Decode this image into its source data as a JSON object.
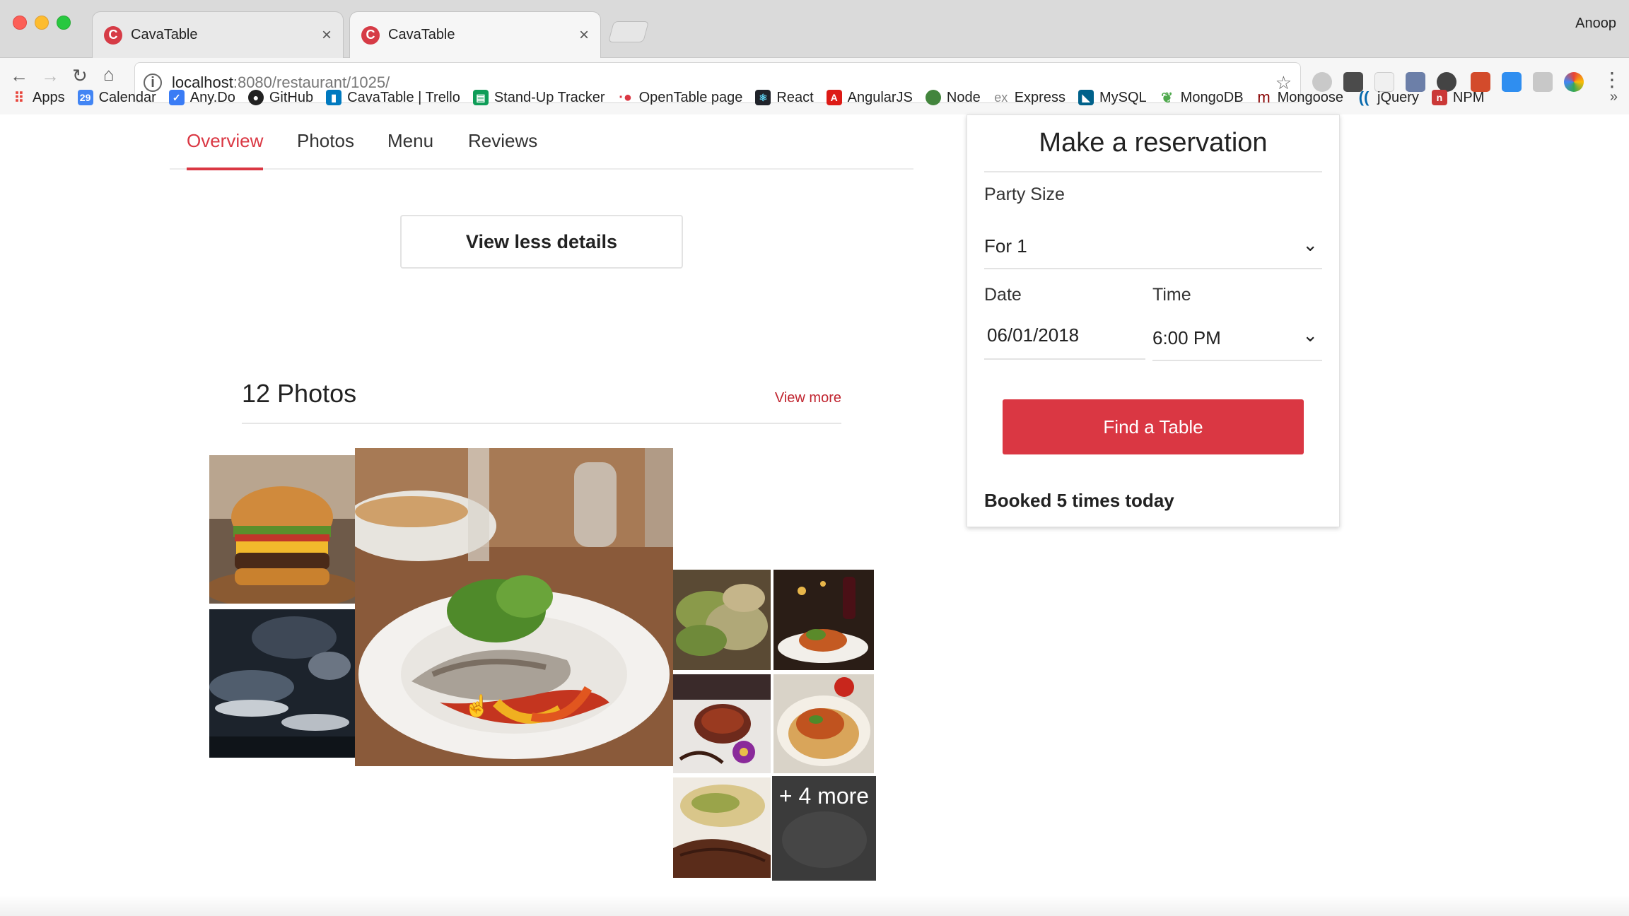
{
  "browser": {
    "tabs": [
      {
        "title": "CavaTable",
        "active": false
      },
      {
        "title": "CavaTable",
        "active": true
      }
    ],
    "profile_name": "Anoop",
    "url_host": "localhost",
    "url_path": ":8080/restaurant/1025/",
    "bookmarks": [
      {
        "label": "Apps",
        "icon": "apps-grid-icon",
        "color": "#e8453c"
      },
      {
        "label": "Calendar",
        "icon": "calendar-icon",
        "color": "#4285f4"
      },
      {
        "label": "Any.Do",
        "icon": "anydo-check-icon",
        "color": "#3a7cf5"
      },
      {
        "label": "GitHub",
        "icon": "github-icon",
        "color": "#222222"
      },
      {
        "label": "CavaTable | Trello",
        "icon": "trello-icon",
        "color": "#0079bf"
      },
      {
        "label": "Stand-Up Tracker",
        "icon": "sheets-icon",
        "color": "#0f9d58"
      },
      {
        "label": "OpenTable page",
        "icon": "opentable-icon",
        "color": "#da3743"
      },
      {
        "label": "React",
        "icon": "react-icon",
        "color": "#20232a"
      },
      {
        "label": "AngularJS",
        "icon": "angular-icon",
        "color": "#dd1b16"
      },
      {
        "label": "Node",
        "icon": "node-icon",
        "color": "#43853d"
      },
      {
        "label": "Express",
        "icon": "express-icon",
        "color": "#888888"
      },
      {
        "label": "MySQL",
        "icon": "mysql-icon",
        "color": "#00618a"
      },
      {
        "label": "MongoDB",
        "icon": "mongodb-leaf-icon",
        "color": "#4fa94d"
      },
      {
        "label": "Mongoose",
        "icon": "mongoose-icon",
        "color": "#880000"
      },
      {
        "label": "jQuery",
        "icon": "jquery-icon",
        "color": "#0769ad"
      },
      {
        "label": "NPM",
        "icon": "npm-icon",
        "color": "#cb3837"
      }
    ]
  },
  "restaurant_nav": {
    "tabs": [
      "Overview",
      "Photos",
      "Menu",
      "Reviews"
    ],
    "active": "Overview"
  },
  "details_button": "View less details",
  "photos": {
    "title": "12 Photos",
    "view_more": "View more",
    "more_overlay": "+ 4 more"
  },
  "reservation": {
    "title": "Make a reservation",
    "party_label": "Party Size",
    "party_prefix": "For",
    "party_value": "1",
    "date_label": "Date",
    "date_value": "06/01/2018",
    "time_label": "Time",
    "time_value": "6:00 PM",
    "find_button": "Find a Table",
    "booked_text": "Booked 5 times today"
  },
  "colors": {
    "brand_red": "#da3743",
    "link_red": "#c0242f"
  }
}
